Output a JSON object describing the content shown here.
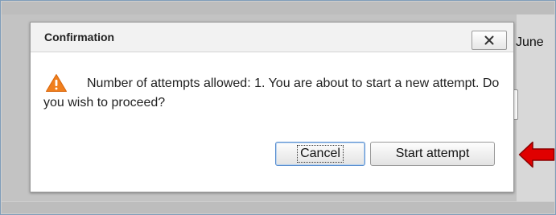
{
  "background": {
    "partial_text": "June"
  },
  "dialog": {
    "title": "Confirmation",
    "close_symbol": "✕",
    "message": "Number of attempts allowed: 1. You are about to start a new attempt. Do you wish to proceed?",
    "icon": "warning-icon",
    "buttons": {
      "cancel": "Cancel",
      "start": "Start attempt"
    }
  },
  "annotation": {
    "icon": "red-arrow-icon",
    "color": "#e00000"
  },
  "colors": {
    "warning": "#f07f1d",
    "dialog_header": "#f2f2f2",
    "focus_border": "#5a8fd0"
  }
}
